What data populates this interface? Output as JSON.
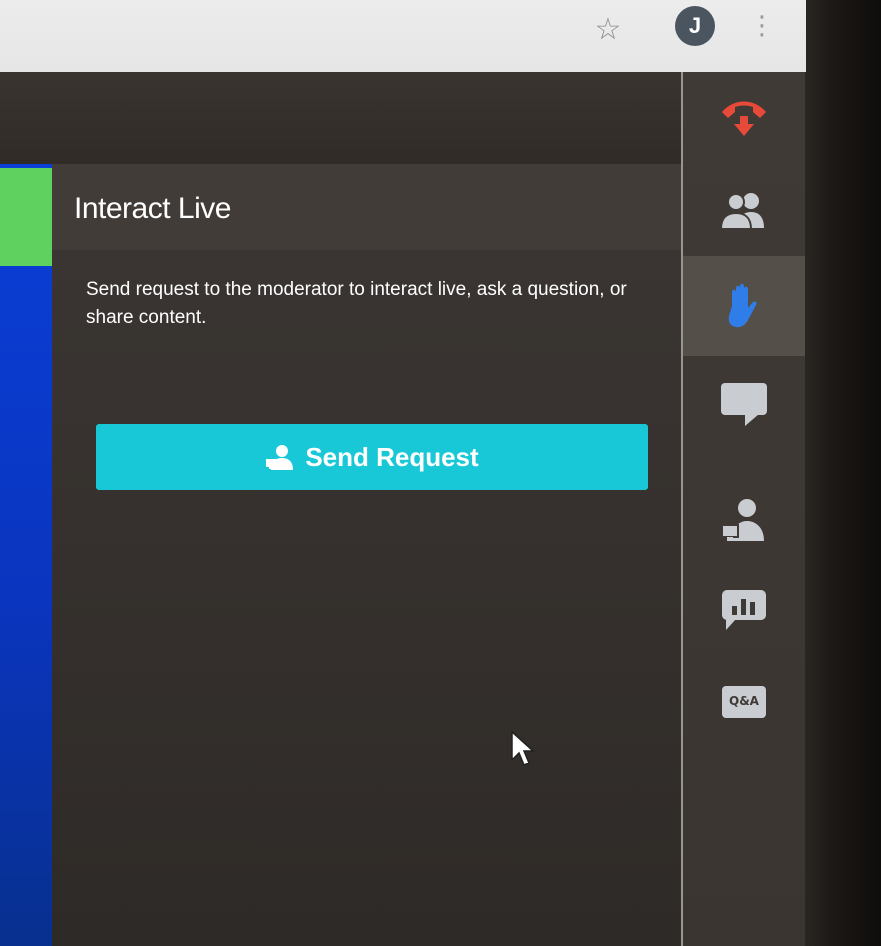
{
  "browser": {
    "star_icon": "star-icon",
    "avatar_initial": "J",
    "menu_glyph": "⋮"
  },
  "panel": {
    "title": "Interact Live",
    "description": "Send request to the moderator to interact live, ask a question, or share content.",
    "send_button_label": "Send Request"
  },
  "sidebar": {
    "items": [
      {
        "name": "leave-call",
        "icon": "phone-hangup-icon",
        "color": "#e84a3a"
      },
      {
        "name": "participants",
        "icon": "participants-icon",
        "color": "#c9cdd2"
      },
      {
        "name": "interact-live",
        "icon": "raised-hand-icon",
        "color": "#2f7de8"
      },
      {
        "name": "chat",
        "icon": "chat-bubble-icon",
        "color": "#c9cdd2"
      },
      {
        "name": "presenter",
        "icon": "presenter-icon",
        "color": "#c9cdd2"
      },
      {
        "name": "polls",
        "icon": "poll-icon",
        "color": "#c9cdd2"
      },
      {
        "name": "qa",
        "icon": "qa-icon",
        "label": "Q&A",
        "color": "#c9cdd2"
      }
    ]
  },
  "colors": {
    "accent_button": "#19c8d6",
    "stage_blue": "#0a3fd8",
    "stage_green": "#5fd15f",
    "panel_bg": "#3b3633"
  }
}
